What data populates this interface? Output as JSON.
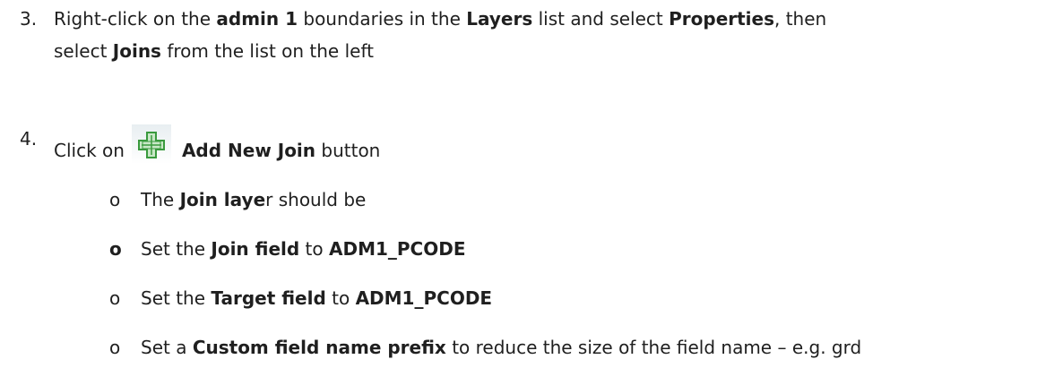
{
  "steps": [
    {
      "number": "3.",
      "line1": {
        "t1": "Right-click on the ",
        "b1": "admin 1",
        "t2": " boundaries in the ",
        "b2": "Layers",
        "t3": " list and select ",
        "b3": "Properties",
        "t4": ", then"
      },
      "line2": {
        "t1": "select ",
        "b1": "Joins",
        "t2": " from the list on the left"
      }
    },
    {
      "number": "4.",
      "line": {
        "t1": "Click on",
        "b1": "Add New Join",
        "t2": " button"
      },
      "icon": "add-join-plus-icon"
    }
  ],
  "bullets": [
    {
      "marker": "o",
      "t1": "The ",
      "b1": "Join laye",
      "t2": "r should be"
    },
    {
      "marker": "o",
      "t1": "Set the ",
      "b1": "Join field",
      "t2": " to ",
      "b2": "ADM1_PCODE"
    },
    {
      "marker": "o",
      "t1": "Set the ",
      "b1": "Target field",
      "t2": " to ",
      "b2": "ADM1_PCODE"
    },
    {
      "marker": "o",
      "t1": "Set a ",
      "b1": "Custom field name prefix",
      "t2": " to reduce the size of the field name – e.g. grd"
    }
  ],
  "colors": {
    "text": "#1f1f1f",
    "icon_green": "#3a9a3e",
    "icon_fill": "#c8e7c6"
  }
}
